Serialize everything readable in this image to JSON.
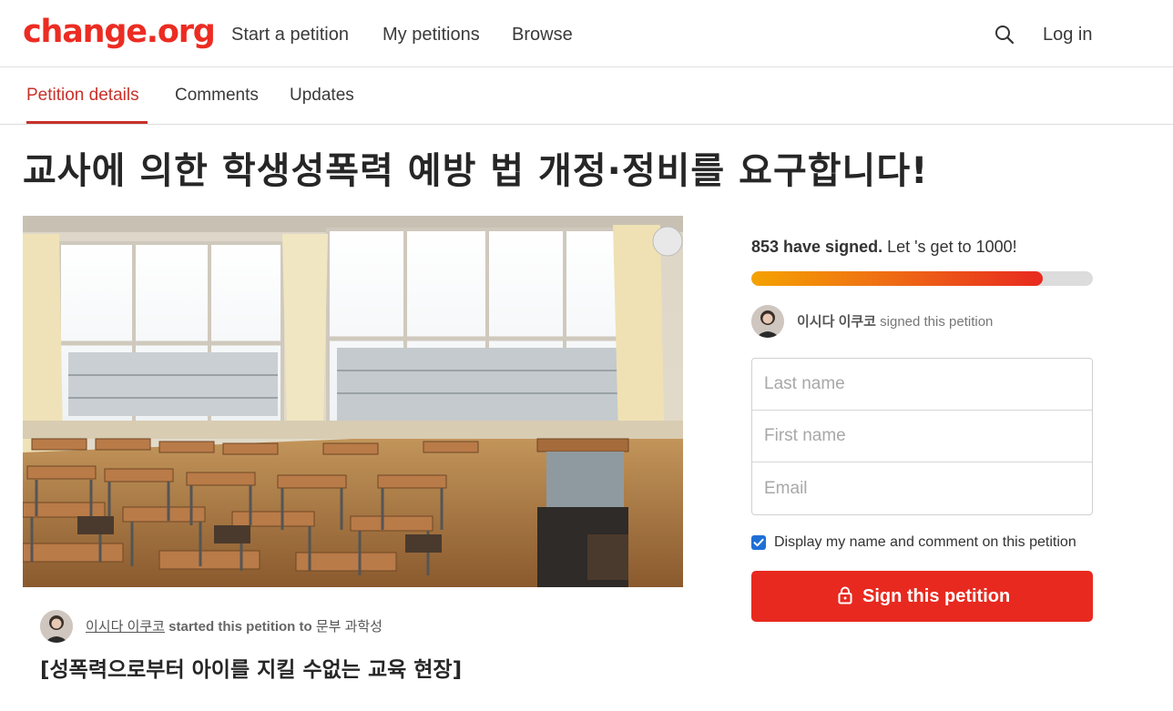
{
  "brand": {
    "logo_text": "change.org",
    "accent": "#ec2c22"
  },
  "nav": {
    "links": [
      "Start a petition",
      "My petitions",
      "Browse"
    ],
    "search_icon": "search-icon",
    "login": "Log in"
  },
  "tabs": {
    "items": [
      "Petition details",
      "Comments",
      "Updates"
    ],
    "active": "Petition details"
  },
  "petition": {
    "title": "교사에 의한 학생성폭력 예방 법 개정·정비를 요구합니다!",
    "image_alt": "classroom photo",
    "starter_name": "이시다 이쿠코",
    "starter_action": "started this petition to",
    "recipient": "문부 과학성",
    "subheading": "[성폭력으로부터 아이를 지킬 수없는 교육 현장]"
  },
  "sign_panel": {
    "signed_count": "853 have signed.",
    "goal_text": "Let 's get to 1000!",
    "progress_fraction": 0.853,
    "recent_signer_name": "이시다 이쿠코",
    "recent_signer_action": "signed this petition",
    "fields": {
      "last_name_placeholder": "Last name",
      "first_name_placeholder": "First name",
      "email_placeholder": "Email"
    },
    "display_checkbox_checked": true,
    "display_checkbox_label": "Display my name and comment on this petition",
    "sign_button": "Sign this petition",
    "sign_button_color": "#e8291f",
    "lock_icon": "lock-icon"
  }
}
